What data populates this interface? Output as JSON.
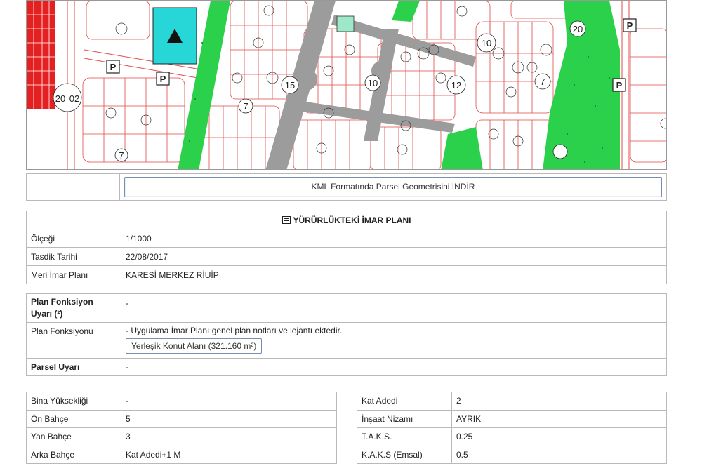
{
  "map": {
    "parking_label": "P",
    "parcel_labels": [
      "20",
      "02",
      "15",
      "10",
      "12",
      "7",
      "7",
      "20",
      "10",
      "7"
    ],
    "colors": {
      "parcel_line": "#e04a4a",
      "road": "#9c9c9c",
      "green": "#2bd14a",
      "park_cyan": "#27d6d6",
      "dense_red": "#e42020"
    }
  },
  "kml": {
    "button_label": "KML Formatında Parsel Geometrisini İNDİR"
  },
  "plan": {
    "heading": "YÜRÜRLÜKTEKİ İMAR PLANI",
    "rows": [
      {
        "label": "Ölçeği",
        "value": "1/1000"
      },
      {
        "label": "Tasdik Tarihi",
        "value": "22/08/2017"
      },
      {
        "label": "Meri İmar Planı",
        "value": "KARESİ MERKEZ RİUİP"
      }
    ]
  },
  "function": {
    "warning_label": "Plan Fonksiyon Uyarı (²)",
    "warning_value": "-",
    "function_label": "Plan Fonksiyonu",
    "function_note": "- Uygulama İmar Planı genel plan notları ve lejantı ektedir.",
    "function_button": "Yerleşik Konut Alanı (321.160 m²)",
    "parcel_warning_label": "Parsel Uyarı",
    "parcel_warning_value": "-"
  },
  "details_left": [
    {
      "label": "Bina Yüksekliği",
      "value": "-"
    },
    {
      "label": "Ön Bahçe",
      "value": "5"
    },
    {
      "label": "Yan Bahçe",
      "value": "3"
    },
    {
      "label": "Arka Bahçe",
      "value": "Kat Adedi+1 M"
    }
  ],
  "details_right": [
    {
      "label": "Kat Adedi",
      "value": "2"
    },
    {
      "label": "İnşaat Nizamı",
      "value": "AYRIK"
    },
    {
      "label": "T.A.K.S.",
      "value": "0.25"
    },
    {
      "label": "K.A.K.S (Emsal)",
      "value": "0.5"
    }
  ]
}
